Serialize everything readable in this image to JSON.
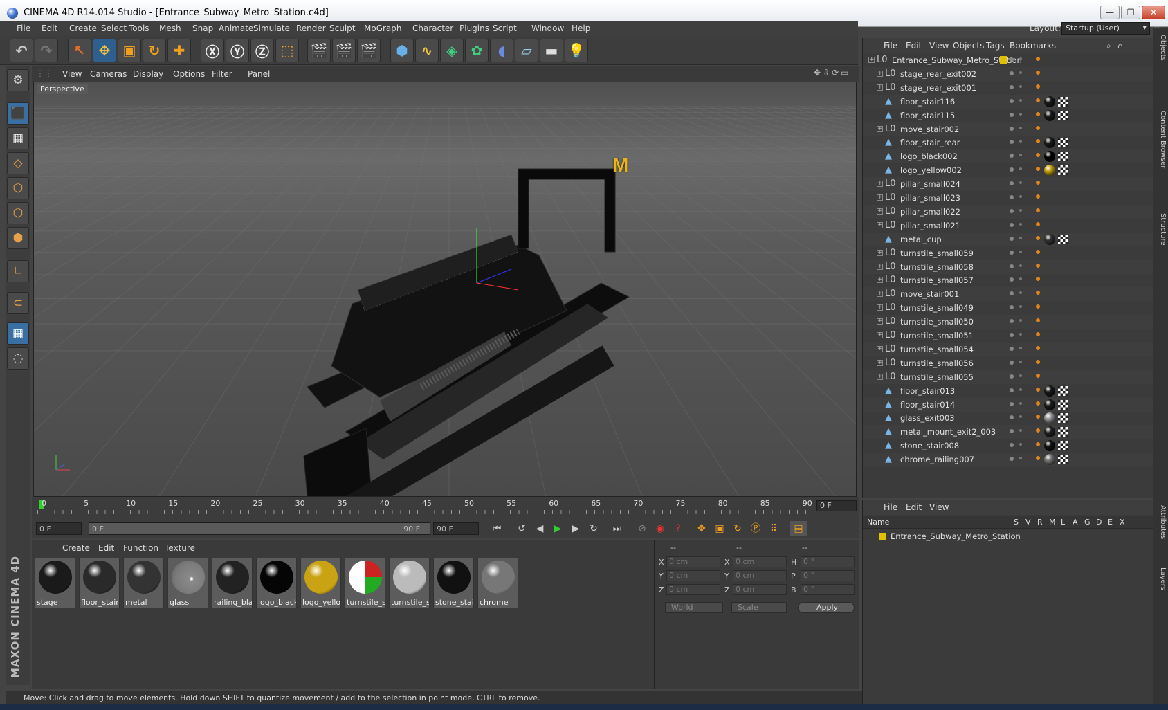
{
  "window": {
    "title": "CINEMA 4D R14.014 Studio - [Entrance_Subway_Metro_Station.c4d]",
    "minimize": "—",
    "maximize": "❐",
    "close": "✕"
  },
  "menubar": [
    "File",
    "Edit",
    "Create",
    "Select",
    "Tools",
    "Mesh",
    "Snap",
    "Animate",
    "Simulate",
    "Render",
    "Sculpt",
    "MoGraph",
    "Character",
    "Plugins",
    "Script",
    "Window",
    "Help"
  ],
  "layout": {
    "label": "Layout:",
    "value": "Startup (User)"
  },
  "viewport": {
    "menu": [
      "View",
      "Cameras",
      "Display",
      "Options",
      "Filter",
      "Panel"
    ],
    "label": "Perspective",
    "logo": "M"
  },
  "timeline": {
    "ticks": [
      "0",
      "5",
      "10",
      "15",
      "20",
      "25",
      "30",
      "35",
      "40",
      "45",
      "50",
      "55",
      "60",
      "65",
      "70",
      "75",
      "80",
      "85",
      "90"
    ],
    "current_frame": "0 F"
  },
  "transport": {
    "start": "0 F",
    "range_start": "0 F",
    "range_end": "90 F",
    "end": "90 F"
  },
  "materials": {
    "menu": [
      "Create",
      "Edit",
      "Function",
      "Texture"
    ],
    "items": [
      {
        "name": "stage",
        "color": "#1a1a1a"
      },
      {
        "name": "floor_stair",
        "color": "#2a2a2a"
      },
      {
        "name": "metal",
        "color": "#333333"
      },
      {
        "name": "glass",
        "color": "#9a9a9a"
      },
      {
        "name": "railing_blac",
        "color": "#222222"
      },
      {
        "name": "logo_black",
        "color": "#050505"
      },
      {
        "name": "logo_yellov",
        "color": "#c9a313"
      },
      {
        "name": "turnstile_st",
        "color": "#cc2020"
      },
      {
        "name": "turnstile_st",
        "color": "#bbbbbb"
      },
      {
        "name": "stone_stair",
        "color": "#111111"
      },
      {
        "name": "chrome",
        "color": "#777777"
      }
    ]
  },
  "coords": {
    "headers": [
      "--",
      "--",
      "--"
    ],
    "rows": [
      {
        "a": "X",
        "av": "0 cm",
        "b": "X",
        "bv": "0 cm",
        "c": "H",
        "cv": "0 °"
      },
      {
        "a": "Y",
        "av": "0 cm",
        "b": "Y",
        "bv": "0 cm",
        "c": "P",
        "cv": "0 °"
      },
      {
        "a": "Z",
        "av": "0 cm",
        "b": "Z",
        "bv": "0 cm",
        "c": "B",
        "cv": "0 °"
      }
    ],
    "mode": "World",
    "scale": "Scale",
    "apply": "Apply"
  },
  "status": "Move: Click and drag to move elements. Hold down SHIFT to quantize movement / add to the selection in point mode, CTRL to remove.",
  "objects": {
    "menu": [
      "File",
      "Edit",
      "View",
      "Objects",
      "Tags",
      "Bookmarks"
    ],
    "items": [
      {
        "name": "Entrance_Subway_Metro_Station",
        "type": "null",
        "root": true
      },
      {
        "name": "stage_rear_exit002",
        "type": "null"
      },
      {
        "name": "stage_rear_exit001",
        "type": "null"
      },
      {
        "name": "floor_stair116",
        "type": "poly",
        "mat": "#1a1a1a"
      },
      {
        "name": "floor_stair115",
        "type": "poly",
        "mat": "#1a1a1a"
      },
      {
        "name": "move_stair002",
        "type": "null"
      },
      {
        "name": "floor_stair_rear",
        "type": "poly",
        "mat": "#1a1a1a"
      },
      {
        "name": "logo_black002",
        "type": "poly",
        "mat": "#050505"
      },
      {
        "name": "logo_yellow002",
        "type": "poly",
        "mat": "#c9a313"
      },
      {
        "name": "pillar_small024",
        "type": "null"
      },
      {
        "name": "pillar_small023",
        "type": "null"
      },
      {
        "name": "pillar_small022",
        "type": "null"
      },
      {
        "name": "pillar_small021",
        "type": "null"
      },
      {
        "name": "metal_cup",
        "type": "poly",
        "mat": "#333333"
      },
      {
        "name": "turnstile_small059",
        "type": "null"
      },
      {
        "name": "turnstile_small058",
        "type": "null"
      },
      {
        "name": "turnstile_small057",
        "type": "null"
      },
      {
        "name": "move_stair001",
        "type": "null"
      },
      {
        "name": "turnstile_small049",
        "type": "null"
      },
      {
        "name": "turnstile_small050",
        "type": "null"
      },
      {
        "name": "turnstile_small051",
        "type": "null"
      },
      {
        "name": "turnstile_small054",
        "type": "null"
      },
      {
        "name": "turnstile_small056",
        "type": "null"
      },
      {
        "name": "turnstile_small055",
        "type": "null"
      },
      {
        "name": "floor_stair013",
        "type": "poly",
        "mat": "#1a1a1a"
      },
      {
        "name": "floor_stair014",
        "type": "poly",
        "mat": "#1a1a1a"
      },
      {
        "name": "glass_exit003",
        "type": "poly",
        "mat": "#9a9a9a"
      },
      {
        "name": "metal_mount_exit2_003",
        "type": "poly",
        "mat": "#222222"
      },
      {
        "name": "stone_stair008",
        "type": "poly",
        "mat": "#111111"
      },
      {
        "name": "chrome_railing007",
        "type": "poly",
        "mat": "#777777"
      }
    ]
  },
  "layers": {
    "menu": [
      "File",
      "Edit",
      "View"
    ],
    "columns": [
      "Name",
      "S",
      "V",
      "R",
      "M",
      "L",
      "A",
      "G",
      "D",
      "E",
      "X"
    ],
    "row": "Entrance_Subway_Metro_Station"
  },
  "side_tabs": [
    "Objects",
    "Content Browser",
    "Structure",
    "Attributes",
    "Layers"
  ]
}
